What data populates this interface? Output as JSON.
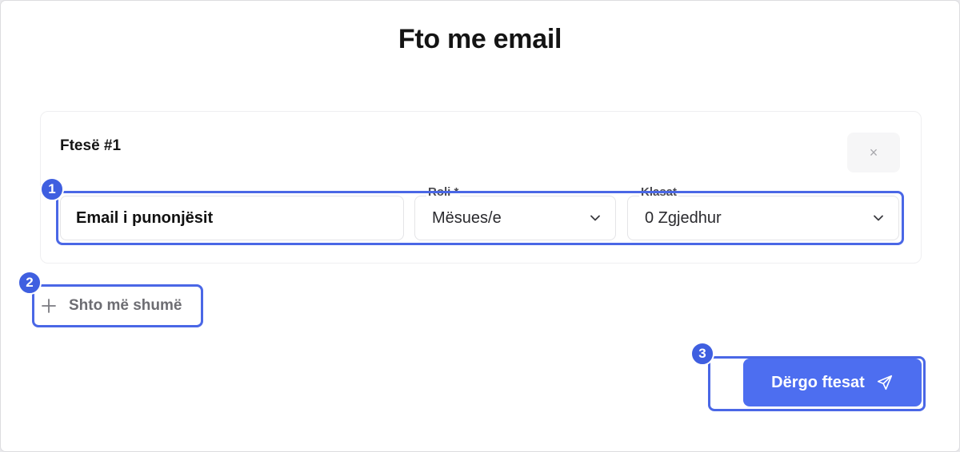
{
  "dialog": {
    "title": "Fto me email"
  },
  "invite": {
    "heading": "Ftesë #1",
    "remove_symbol": "×",
    "email_placeholder": "Email i punonjësit",
    "role_label": "Roli *",
    "role_value": "Mësues/e",
    "classes_label": "Klasat",
    "classes_value": "0 Zgjedhur"
  },
  "actions": {
    "add_more_label": "Shto më shumë",
    "send_label": "Dërgo ftesat"
  },
  "annotations": {
    "badge_1": "1",
    "badge_2": "2",
    "badge_3": "3"
  },
  "colors": {
    "accent": "#4d6ef0",
    "annotation": "#4a67e6"
  },
  "icons": {
    "remove": "close-icon",
    "dropdown": "chevron-down-icon",
    "add": "plus-icon",
    "send": "send-icon"
  }
}
